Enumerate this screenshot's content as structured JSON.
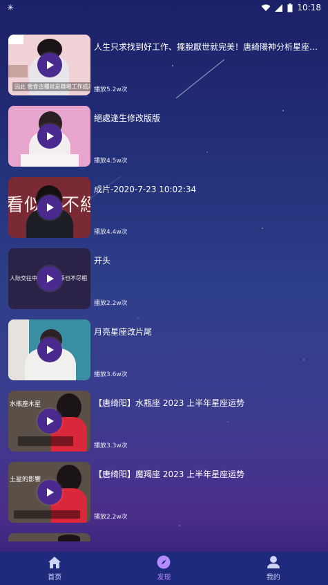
{
  "status": {
    "time": "10:18"
  },
  "videos": [
    {
      "title": "人生只求找到好工作、擺脫厭世就完美！唐綺陽神分析星座知Vog…",
      "plays": "播放5.2w次",
      "thumb_caption": "因此 我會這種就是職場工作成為"
    },
    {
      "title": "絕處逢生修改版版",
      "plays": "播放4.5w次"
    },
    {
      "title": "成片-2020-7-23 10:02:34",
      "plays": "播放4.4w次",
      "thumb_text": "看似　不經"
    },
    {
      "title": "开头",
      "plays": "播放2.2w次",
      "thumb_text": "人际交往中别　　关系也不尽相"
    },
    {
      "title": "月亮星座改片尾",
      "plays": "播放3.6w次"
    },
    {
      "title": "【唐绮阳】水瓶座 2023 上半年星座运势",
      "plays": "播放3.3w次",
      "thumb_text": "水瓶座木星"
    },
    {
      "title": "【唐绮阳】魔羯座 2023 上半年星座运势",
      "plays": "播放2.2w次",
      "thumb_text": "土星的影響"
    }
  ],
  "tabs": [
    {
      "label": "首页",
      "icon": "home-icon"
    },
    {
      "label": "发现",
      "icon": "compass-icon"
    },
    {
      "label": "我的",
      "icon": "person-icon"
    }
  ],
  "colors": {
    "accent": "#b58cff",
    "tabbar": "#1e2a7c",
    "play": "#4b2a8f"
  }
}
